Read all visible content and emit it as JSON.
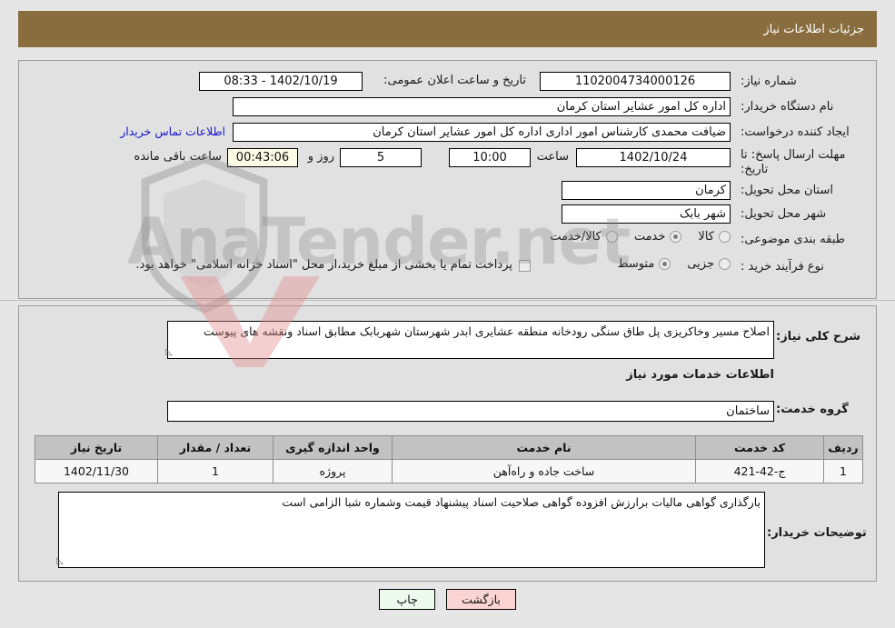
{
  "header": {
    "title": "جزئیات اطلاعات نیاز"
  },
  "form": {
    "need_number_label": "شماره نیاز:",
    "need_number_value": "1102004734000126",
    "announce_datetime_label": "تاریخ و ساعت اعلان عمومی:",
    "announce_datetime_value": "1402/10/19 - 08:33",
    "buyer_org_label": "نام دستگاه خریدار:",
    "buyer_org_value": "اداره کل امور عشایر استان کرمان",
    "requester_label": "ایجاد کننده درخواست:",
    "requester_value": "ضیافت محمدی کارشناس امور اداری اداره کل امور عشایر استان کرمان",
    "contact_link": "اطلاعات تماس خریدار",
    "deadline_label": "مهلت ارسال پاسخ: تا تاریخ:",
    "deadline_date_value": "1402/10/24",
    "hour_label": "ساعت",
    "deadline_time_value": "10:00",
    "days_value": "5",
    "days_label": "روز و",
    "remaining_time_value": "00:43:06",
    "remaining_label": "ساعت باقی مانده",
    "province_label": "استان محل تحویل:",
    "province_value": "کرمان",
    "city_label": "شهر محل تحویل:",
    "city_value": "شهر بابک",
    "category_label": "طبقه بندی موضوعی:",
    "category_options": [
      {
        "label": "کالا",
        "selected": false
      },
      {
        "label": "خدمت",
        "selected": true
      },
      {
        "label": "کالا/خدمت",
        "selected": false
      }
    ],
    "process_type_label": "نوع فرآیند خرید :",
    "process_options": [
      {
        "label": "جزیی",
        "selected": false
      },
      {
        "label": "متوسط",
        "selected": true
      }
    ],
    "treasury_checkbox_checked": false,
    "treasury_note": "پرداخت تمام یا بخشی از مبلغ خرید،از محل \"اسناد خزانه اسلامی\" خواهد بود."
  },
  "details": {
    "general_desc_label": "شرح کلی نیاز:",
    "general_desc_value": "اصلاح مسیر وخاکریزی پل طاق سنگی رودخانه منطقه عشایری ابدر شهرستان شهربابک مطابق اسناد ونقشه های پیوست",
    "services_section_title": "اطلاعات خدمات مورد نیاز",
    "service_group_label": "گروه خدمت:",
    "service_group_value": "ساختمان",
    "buyer_notes_label": "توضیحات خریدار:",
    "buyer_notes_value": "بارگذاری گواهی مالیات برارزش افزوده گواهی صلاحیت اسناد پیشنهاد قیمت وشماره شبا الزامی است"
  },
  "table": {
    "columns": [
      "ردیف",
      "کد خدمت",
      "نام خدمت",
      "واحد اندازه گیری",
      "تعداد / مقدار",
      "تاریخ نیاز"
    ],
    "rows": [
      {
        "row_no": "1",
        "service_code": "ج-42-421",
        "service_name": "ساخت جاده و راه‌آهن",
        "unit": "پروژه",
        "quantity": "1",
        "need_date": "1402/11/30"
      }
    ]
  },
  "buttons": {
    "print": "چاپ",
    "back": "بازگشت"
  },
  "watermark": {
    "text": "AnaTender.net"
  },
  "colors": {
    "header_bar": "#8a6d3f",
    "panel_bg": "#e1e1e1",
    "page_bg": "#e6e6e6",
    "link": "#1414d2",
    "table_header": "#c2c2c2",
    "btn_print": "#eefaee",
    "btn_back": "#fbd4d4"
  }
}
